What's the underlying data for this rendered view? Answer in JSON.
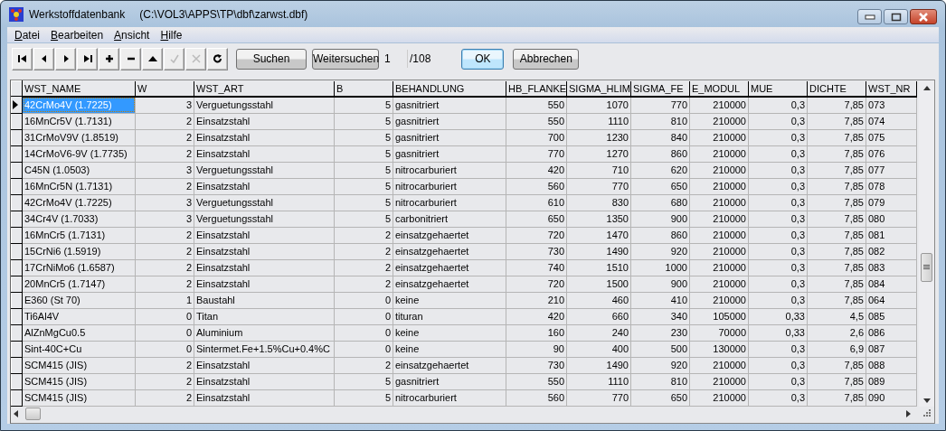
{
  "window": {
    "title": "Werkstoffdatenbank",
    "path": "(C:\\VOL3\\APPS\\TP\\dbf\\zarwst.dbf)"
  },
  "menu": [
    "Datei",
    "Bearbeiten",
    "Ansicht",
    "Hilfe"
  ],
  "toolbar": {
    "nav_buttons": [
      {
        "kind": "first",
        "disabled": false
      },
      {
        "kind": "prev",
        "disabled": false
      },
      {
        "kind": "next",
        "disabled": false
      },
      {
        "kind": "last",
        "disabled": false
      },
      {
        "kind": "insert",
        "disabled": false
      },
      {
        "kind": "delete",
        "disabled": false
      },
      {
        "kind": "edit",
        "disabled": false
      },
      {
        "kind": "post",
        "disabled": true
      },
      {
        "kind": "cancel",
        "disabled": true
      },
      {
        "kind": "refresh",
        "disabled": false
      }
    ],
    "search_button": "Suchen",
    "search_next_button": "Weitersuchen",
    "record_field": "1",
    "record_total": "/108",
    "ok_button": "OK",
    "cancel_button": "Abbrechen"
  },
  "table": {
    "columns": [
      {
        "label": "WST_NAME",
        "kind": "text"
      },
      {
        "label": "W",
        "kind": "number"
      },
      {
        "label": "WST_ART",
        "kind": "text"
      },
      {
        "label": "B",
        "kind": "number"
      },
      {
        "label": "BEHANDLUNG",
        "kind": "text"
      },
      {
        "label": "HB_FLANKE",
        "kind": "number"
      },
      {
        "label": "SIGMA_HLIM",
        "kind": "number"
      },
      {
        "label": "SIGMA_FE",
        "kind": "number"
      },
      {
        "label": "E_MODUL",
        "kind": "number"
      },
      {
        "label": "MUE",
        "kind": "number"
      },
      {
        "label": "DICHTE",
        "kind": "number"
      },
      {
        "label": "WST_NR",
        "kind": "text"
      }
    ],
    "rows": [
      {
        "selected": true,
        "cells": [
          "42CrMo4V (1.7225)",
          "3",
          "Verguetungsstahl",
          "5",
          "gasnitriert",
          "550",
          "1070",
          "770",
          "210000",
          "0,3",
          "7,85",
          "073"
        ]
      },
      {
        "selected": false,
        "cells": [
          "16MnCr5V (1.7131)",
          "2",
          "Einsatzstahl",
          "5",
          "gasnitriert",
          "550",
          "1110",
          "810",
          "210000",
          "0,3",
          "7,85",
          "074"
        ]
      },
      {
        "selected": false,
        "cells": [
          "31CrMoV9V (1.8519)",
          "2",
          "Einsatzstahl",
          "5",
          "gasnitriert",
          "700",
          "1230",
          "840",
          "210000",
          "0,3",
          "7,85",
          "075"
        ]
      },
      {
        "selected": false,
        "cells": [
          "14CrMoV6-9V (1.7735)",
          "2",
          "Einsatzstahl",
          "5",
          "gasnitriert",
          "770",
          "1270",
          "860",
          "210000",
          "0,3",
          "7,85",
          "076"
        ]
      },
      {
        "selected": false,
        "cells": [
          "C45N (1.0503)",
          "3",
          "Verguetungsstahl",
          "5",
          "nitrocarburiert",
          "420",
          "710",
          "620",
          "210000",
          "0,3",
          "7,85",
          "077"
        ]
      },
      {
        "selected": false,
        "cells": [
          "16MnCr5N (1.7131)",
          "2",
          "Einsatzstahl",
          "5",
          "nitrocarburiert",
          "560",
          "770",
          "650",
          "210000",
          "0,3",
          "7,85",
          "078"
        ]
      },
      {
        "selected": false,
        "cells": [
          "42CrMo4V (1.7225)",
          "3",
          "Verguetungsstahl",
          "5",
          "nitrocarburiert",
          "610",
          "830",
          "680",
          "210000",
          "0,3",
          "7,85",
          "079"
        ]
      },
      {
        "selected": false,
        "cells": [
          "34Cr4V (1.7033)",
          "3",
          "Verguetungsstahl",
          "5",
          "carbonitriert",
          "650",
          "1350",
          "900",
          "210000",
          "0,3",
          "7,85",
          "080"
        ]
      },
      {
        "selected": false,
        "cells": [
          "16MnCr5 (1.7131)",
          "2",
          "Einsatzstahl",
          "2",
          "einsatzgehaertet",
          "720",
          "1470",
          "860",
          "210000",
          "0,3",
          "7,85",
          "081"
        ]
      },
      {
        "selected": false,
        "cells": [
          "15CrNi6 (1.5919)",
          "2",
          "Einsatzstahl",
          "2",
          "einsatzgehaertet",
          "730",
          "1490",
          "920",
          "210000",
          "0,3",
          "7,85",
          "082"
        ]
      },
      {
        "selected": false,
        "cells": [
          "17CrNiMo6 (1.6587)",
          "2",
          "Einsatzstahl",
          "2",
          "einsatzgehaertet",
          "740",
          "1510",
          "1000",
          "210000",
          "0,3",
          "7,85",
          "083"
        ]
      },
      {
        "selected": false,
        "cells": [
          "20MnCr5 (1.7147)",
          "2",
          "Einsatzstahl",
          "2",
          "einsatzgehaertet",
          "720",
          "1500",
          "900",
          "210000",
          "0,3",
          "7,85",
          "084"
        ]
      },
      {
        "selected": false,
        "cells": [
          "E360 (St 70)",
          "1",
          "Baustahl",
          "0",
          "keine",
          "210",
          "460",
          "410",
          "210000",
          "0,3",
          "7,85",
          "064"
        ]
      },
      {
        "selected": false,
        "cells": [
          "Ti6Al4V",
          "0",
          "Titan",
          "0",
          "tituran",
          "420",
          "660",
          "340",
          "105000",
          "0,33",
          "4,5",
          "085"
        ]
      },
      {
        "selected": false,
        "cells": [
          "AlZnMgCu0.5",
          "0",
          "Aluminium",
          "0",
          "keine",
          "160",
          "240",
          "230",
          "70000",
          "0,33",
          "2,6",
          "086"
        ]
      },
      {
        "selected": false,
        "cells": [
          "Sint-40C+Cu",
          "0",
          "Sintermet.Fe+1.5%Cu+0.4%C",
          "0",
          "keine",
          "90",
          "400",
          "500",
          "130000",
          "0,3",
          "6,9",
          "087"
        ]
      },
      {
        "selected": false,
        "cells": [
          "SCM415 (JIS)",
          "2",
          "Einsatzstahl",
          "2",
          "einsatzgehaertet",
          "730",
          "1490",
          "920",
          "210000",
          "0,3",
          "7,85",
          "088"
        ]
      },
      {
        "selected": false,
        "cells": [
          "SCM415 (JIS)",
          "2",
          "Einsatzstahl",
          "5",
          "gasnitriert",
          "550",
          "1110",
          "810",
          "210000",
          "0,3",
          "7,85",
          "089"
        ]
      },
      {
        "selected": false,
        "cells": [
          "SCM415 (JIS)",
          "2",
          "Einsatzstahl",
          "5",
          "nitrocarburiert",
          "560",
          "770",
          "650",
          "210000",
          "0,3",
          "7,85",
          "090"
        ]
      }
    ]
  }
}
